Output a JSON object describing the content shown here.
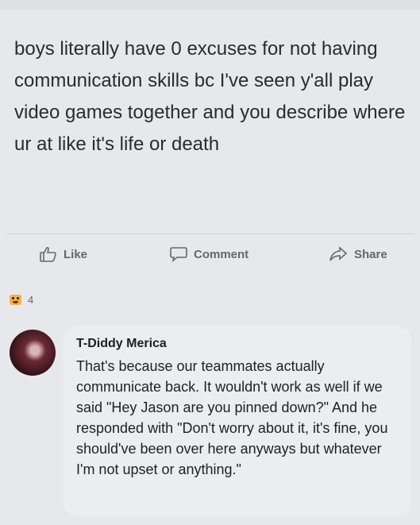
{
  "post": {
    "text": "boys literally have 0 excuses for not having communication skills bc I've seen y'all play video games together and you describe where ur at like it's life or death"
  },
  "actions": {
    "like_label": "Like",
    "comment_label": "Comment",
    "share_label": "Share"
  },
  "reactions": {
    "icon": "emoji-reaction-icon",
    "count": "4"
  },
  "comment": {
    "author": "T-Diddy Merica",
    "text": "That's because our teammates actually communicate back. It wouldn't work as well if we said \"Hey Jason are you pinned down?\" And he responded with \"Don't worry about it, it's fine, you should've been over here anyways but whatever I'm not upset or anything.\""
  },
  "colors": {
    "background": "#e7e8ec",
    "bubble": "#ecedf1",
    "action_text": "#65676b"
  }
}
